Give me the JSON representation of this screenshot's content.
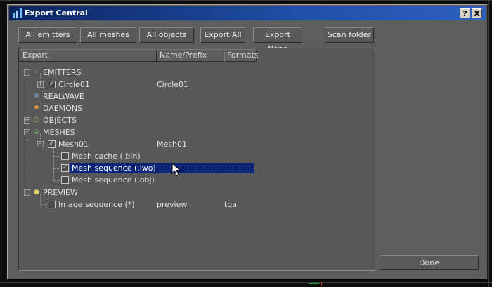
{
  "window": {
    "title": "Export Central",
    "help_glyph": "?",
    "close_glyph": "X"
  },
  "toolbar": {
    "all_emitters": "All emitters",
    "all_meshes": "All meshes",
    "all_objects": "All objects",
    "export_all": "Export All",
    "export_none": "Export None",
    "scan_folder": "Scan folder"
  },
  "tree": {
    "columns": {
      "export": "Export",
      "name_prefix": "Name/Prefix",
      "formats": "Formats"
    },
    "emitters": {
      "label": "EMITTERS",
      "circle": {
        "label": "Circle01",
        "name": "Circle01",
        "checked": true
      }
    },
    "realwave": {
      "label": "REALWAVE"
    },
    "daemons": {
      "label": "DAEMONS"
    },
    "objects": {
      "label": "OBJECTS"
    },
    "meshes": {
      "label": "MESHES",
      "mesh01": {
        "label": "Mesh01",
        "name": "Mesh01",
        "checked": true,
        "items": [
          {
            "label": "Mesh cache (.bin)",
            "checked": false
          },
          {
            "label": "Mesh sequence (.lwo)",
            "checked": true
          },
          {
            "label": "Mesh sequence (.obj)",
            "checked": false
          }
        ]
      }
    },
    "preview": {
      "label": "PREVIEW",
      "image_seq": {
        "label": "Image sequence (*)",
        "name": "preview",
        "format": "tga",
        "checked": false
      }
    },
    "expander_glyphs": {
      "expanded": "-",
      "collapsed": "+"
    },
    "check_glyph": "✓"
  },
  "footer": {
    "done": "Done"
  },
  "colors": {
    "title_start": "#0b2460",
    "title_end": "#2d61c0",
    "selection": "#0c2474",
    "panel": "#5d5d5d"
  },
  "icons": {
    "emitters": "dots-icon",
    "realwave": "wave-icon",
    "daemons": "asterisk-icon",
    "objects": "circle-icon",
    "meshes": "mesh-icon",
    "preview": "bulb-icon"
  }
}
